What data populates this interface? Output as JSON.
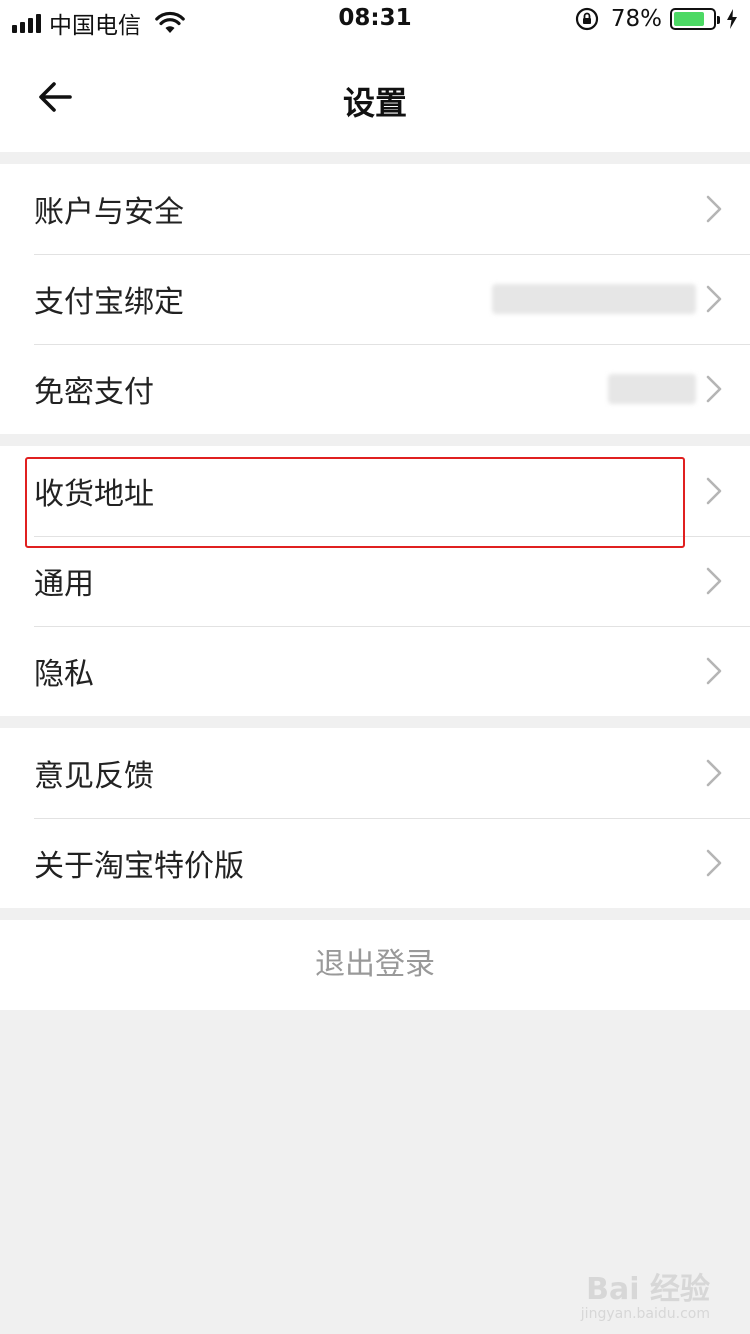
{
  "status_bar": {
    "carrier": "中国电信",
    "time": "08:31",
    "battery": "78%",
    "battery_level": 0.78
  },
  "header": {
    "title": "设置"
  },
  "groups": [
    {
      "items": [
        {
          "label": "账户与安全"
        },
        {
          "label": "支付宝绑定"
        },
        {
          "label": "免密支付"
        }
      ]
    },
    {
      "items": [
        {
          "label": "收货地址"
        },
        {
          "label": "通用"
        },
        {
          "label": "隐私"
        }
      ]
    },
    {
      "items": [
        {
          "label": "意见反馈"
        },
        {
          "label": "关于淘宝特价版"
        }
      ]
    }
  ],
  "logout_label": "退出登录",
  "watermark": {
    "main": "Bai 经验",
    "sub": "jingyan.baidu.com"
  }
}
